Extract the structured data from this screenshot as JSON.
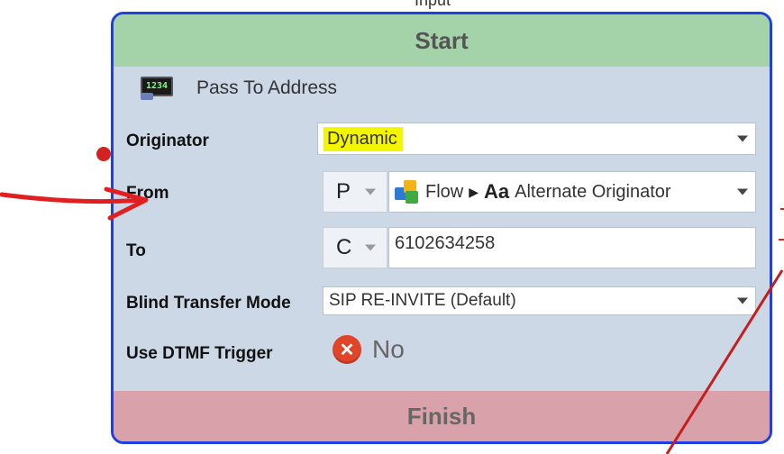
{
  "top_label": "Input",
  "card": {
    "start_label": "Start",
    "finish_label": "Finish",
    "title": "Pass To Address",
    "title_icon_text": "1234",
    "rows": {
      "originator": {
        "label": "Originator",
        "value": "Dynamic"
      },
      "from": {
        "label": "From",
        "prefix": "P",
        "path_root": "Flow",
        "path_leaf": "Alternate Originator"
      },
      "to": {
        "label": "To",
        "prefix": "C",
        "value": "6102634258"
      },
      "blind_transfer": {
        "label": "Blind Transfer Mode",
        "value": "SIP RE-INVITE (Default)"
      },
      "dtmf": {
        "label": "Use DTMF Trigger",
        "value": "No"
      }
    }
  },
  "colors": {
    "card_border": "#1f3fe0",
    "start_bar": "#a5d3a9",
    "finish_bar": "#d9a1aa",
    "highlight": "#f4f600",
    "annotation": "#e02020"
  },
  "icons": {
    "title": "digital-display-icon",
    "flow": "flow-blocks-icon",
    "variable": "text-variable-icon",
    "dtmf": "red-x-circle-icon"
  }
}
